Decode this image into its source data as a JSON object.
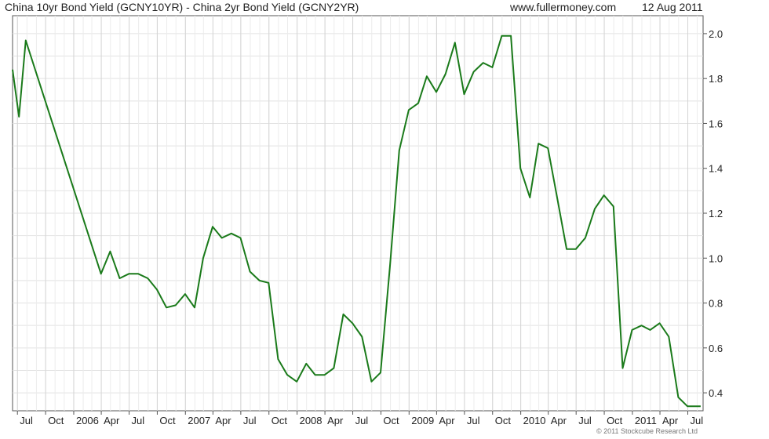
{
  "header": {
    "title": "China 10yr Bond Yield (GCNY10YR) - China 2yr Bond Yield (GCNY2YR)",
    "site": "www.fullermoney.com",
    "date": "12 Aug 2011"
  },
  "footer": {
    "credit": "© 2011 Stockcube Research Ltd"
  },
  "chart_data": {
    "type": "line",
    "title": "China 10yr Bond Yield (GCNY10YR) - China 2yr Bond Yield (GCNY2YR)",
    "xlabel": "",
    "ylabel": "",
    "ylim": [
      0.32,
      2.08
    ],
    "xlim": [
      "2005-06-15",
      "2011-08-20"
    ],
    "grid": true,
    "color": "#1a7a1a",
    "y_ticks": [
      0.4,
      0.6,
      0.8,
      1.0,
      1.2,
      1.4,
      1.6,
      1.8,
      2.0
    ],
    "y_tick_labels": [
      "0.4",
      "0.6",
      "0.8",
      "1.0",
      "1.2",
      "1.4",
      "1.6",
      "1.8",
      "2.0"
    ],
    "x_ticks": [
      {
        "label": "Jul",
        "date": "2005-07-01"
      },
      {
        "label": "Oct",
        "date": "2005-10-01"
      },
      {
        "label": "2006",
        "date": "2006-01-01"
      },
      {
        "label": "Apr",
        "date": "2006-04-01"
      },
      {
        "label": "Jul",
        "date": "2006-07-01"
      },
      {
        "label": "Oct",
        "date": "2006-10-01"
      },
      {
        "label": "2007",
        "date": "2007-01-01"
      },
      {
        "label": "Apr",
        "date": "2007-04-01"
      },
      {
        "label": "Jul",
        "date": "2007-07-01"
      },
      {
        "label": "Oct",
        "date": "2007-10-01"
      },
      {
        "label": "2008",
        "date": "2008-01-01"
      },
      {
        "label": "Apr",
        "date": "2008-04-01"
      },
      {
        "label": "Jul",
        "date": "2008-07-01"
      },
      {
        "label": "Oct",
        "date": "2008-10-01"
      },
      {
        "label": "2009",
        "date": "2009-01-01"
      },
      {
        "label": "Apr",
        "date": "2009-04-01"
      },
      {
        "label": "Jul",
        "date": "2009-07-01"
      },
      {
        "label": "Oct",
        "date": "2009-10-01"
      },
      {
        "label": "2010",
        "date": "2010-01-01"
      },
      {
        "label": "Apr",
        "date": "2010-04-01"
      },
      {
        "label": "Jul",
        "date": "2010-07-01"
      },
      {
        "label": "Oct",
        "date": "2010-10-01"
      },
      {
        "label": "2011",
        "date": "2011-01-01"
      },
      {
        "label": "Apr",
        "date": "2011-04-01"
      },
      {
        "label": "Jul",
        "date": "2011-07-01"
      }
    ],
    "series": [
      {
        "points": [
          [
            "2005-06-15",
            1.84
          ],
          [
            "2005-07-06",
            1.63
          ],
          [
            "2005-07-28",
            1.97
          ],
          [
            "2006-03-31",
            0.93
          ],
          [
            "2006-04-30",
            1.03
          ],
          [
            "2006-05-31",
            0.91
          ],
          [
            "2006-06-30",
            0.93
          ],
          [
            "2006-07-31",
            0.93
          ],
          [
            "2006-08-31",
            0.91
          ],
          [
            "2006-09-30",
            0.86
          ],
          [
            "2006-10-31",
            0.78
          ],
          [
            "2006-11-30",
            0.79
          ],
          [
            "2006-12-31",
            0.84
          ],
          [
            "2007-01-31",
            0.78
          ],
          [
            "2007-02-28",
            1.0
          ],
          [
            "2007-03-31",
            1.14
          ],
          [
            "2007-04-30",
            1.09
          ],
          [
            "2007-05-31",
            1.11
          ],
          [
            "2007-06-30",
            1.09
          ],
          [
            "2007-07-31",
            0.94
          ],
          [
            "2007-08-31",
            0.9
          ],
          [
            "2007-09-30",
            0.89
          ],
          [
            "2007-10-31",
            0.55
          ],
          [
            "2007-11-30",
            0.48
          ],
          [
            "2007-12-31",
            0.45
          ],
          [
            "2008-01-31",
            0.53
          ],
          [
            "2008-02-29",
            0.48
          ],
          [
            "2008-03-31",
            0.48
          ],
          [
            "2008-04-30",
            0.51
          ],
          [
            "2008-05-31",
            0.75
          ],
          [
            "2008-06-30",
            0.71
          ],
          [
            "2008-07-31",
            0.65
          ],
          [
            "2008-08-31",
            0.45
          ],
          [
            "2008-09-30",
            0.49
          ],
          [
            "2008-10-31",
            0.97
          ],
          [
            "2008-11-30",
            1.48
          ],
          [
            "2008-12-31",
            1.66
          ],
          [
            "2009-01-31",
            1.69
          ],
          [
            "2009-02-28",
            1.81
          ],
          [
            "2009-03-31",
            1.74
          ],
          [
            "2009-04-30",
            1.82
          ],
          [
            "2009-05-31",
            1.96
          ],
          [
            "2009-06-30",
            1.73
          ],
          [
            "2009-07-31",
            1.83
          ],
          [
            "2009-08-31",
            1.87
          ],
          [
            "2009-09-30",
            1.85
          ],
          [
            "2009-10-31",
            1.99
          ],
          [
            "2009-11-30",
            1.99
          ],
          [
            "2009-12-31",
            1.4
          ],
          [
            "2010-01-31",
            1.27
          ],
          [
            "2010-02-28",
            1.51
          ],
          [
            "2010-03-31",
            1.49
          ],
          [
            "2010-04-30",
            1.27
          ],
          [
            "2010-05-31",
            1.04
          ],
          [
            "2010-06-30",
            1.04
          ],
          [
            "2010-07-31",
            1.09
          ],
          [
            "2010-08-31",
            1.22
          ],
          [
            "2010-09-30",
            1.28
          ],
          [
            "2010-10-31",
            1.23
          ],
          [
            "2010-11-30",
            0.51
          ],
          [
            "2010-12-31",
            0.68
          ],
          [
            "2011-01-31",
            0.7
          ],
          [
            "2011-02-28",
            0.68
          ],
          [
            "2011-03-31",
            0.71
          ],
          [
            "2011-04-30",
            0.65
          ],
          [
            "2011-05-31",
            0.38
          ],
          [
            "2011-06-30",
            0.34
          ],
          [
            "2011-08-12",
            0.34
          ]
        ]
      }
    ]
  }
}
